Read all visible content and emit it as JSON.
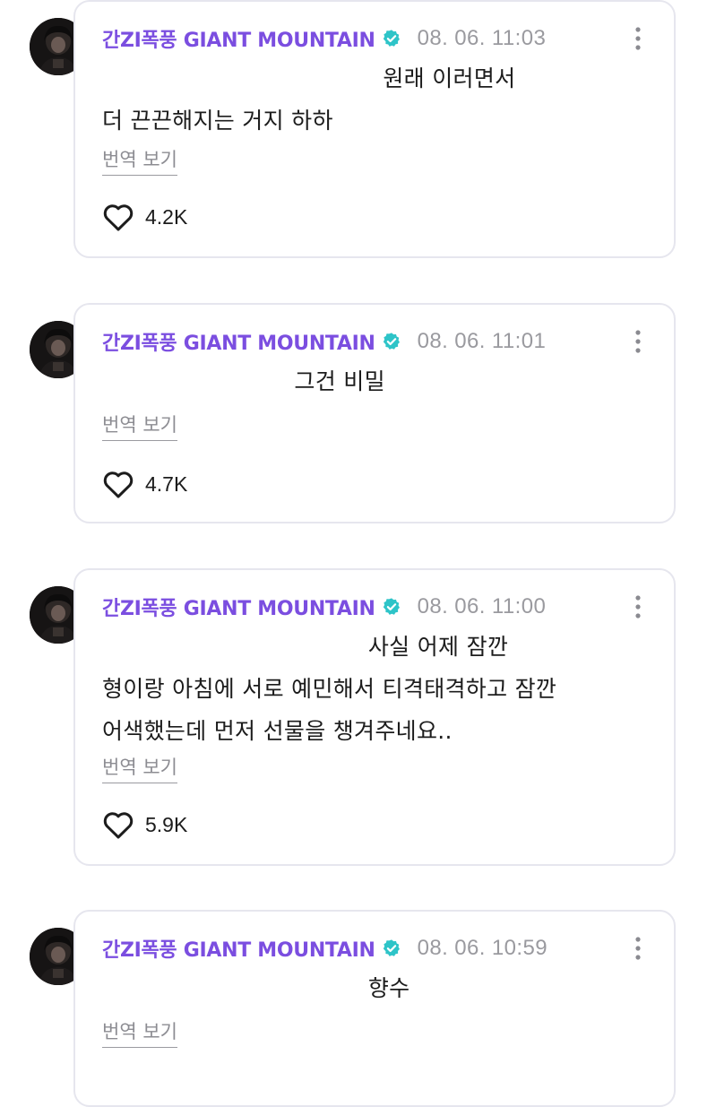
{
  "comments": [
    {
      "author": "간ZI폭풍 GIANT MOUNTAIN",
      "timestamp": "08. 06. 11:03",
      "text": "                                      원래 이러면서\n더 끈끈해지는 거지 하하",
      "translate_label": "번역 보기",
      "likes": "4.2K"
    },
    {
      "author": "간ZI폭풍 GIANT MOUNTAIN",
      "timestamp": "08. 06. 11:01",
      "text": "                          그건 비밀",
      "translate_label": "번역 보기",
      "likes": "4.7K"
    },
    {
      "author": "간ZI폭풍 GIANT MOUNTAIN",
      "timestamp": "08. 06. 11:00",
      "text": "                                    사실 어제 잠깐\n형이랑 아침에 서로 예민해서 티격태격하고 잠깐\n어색했는데 먼저 선물을 챙겨주네요..",
      "translate_label": "번역 보기",
      "likes": "5.9K"
    },
    {
      "author": "간ZI폭풍 GIANT MOUNTAIN",
      "timestamp": "08. 06. 10:59",
      "text": "                                    향수",
      "translate_label": "번역 보기",
      "likes": ""
    }
  ],
  "icons": {
    "verified": "verified-badge-icon",
    "more": "more-vertical-icon",
    "like": "heart-outline-icon"
  },
  "colors": {
    "author_name": "#7b4ee0",
    "verified_badge": "#2ec4c8",
    "timestamp": "#9a9a9f",
    "card_border": "#e6e6ee"
  }
}
